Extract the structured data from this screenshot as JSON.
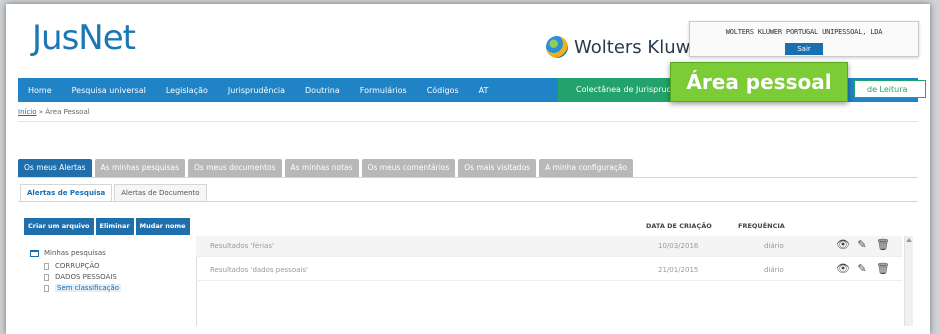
{
  "header": {
    "logo": "JusNet",
    "brand": "Wolters Kluwer",
    "company_name": "WOLTERS KLUWER PORTUGAL UNIPESSOAL, LDA",
    "logout_label": "Sair"
  },
  "nav": {
    "items": [
      "Home",
      "Pesquisa universal",
      "Legislação",
      "Jurisprudência",
      "Doutrina",
      "Formulários",
      "Códigos",
      "AT"
    ],
    "collection_label": "Colectânea de Jurisprudência",
    "reading_label": "de Leitura"
  },
  "badge": {
    "label": "Área pessoal"
  },
  "breadcrumb": {
    "home": "Início",
    "separator": " » ",
    "current": "Área Pessoal"
  },
  "tabs": [
    "Os meus Alertas",
    "As minhas pesquisas",
    "Os meus documentos",
    "As minhas notas",
    "Os meus comentários",
    "Os mais visitados",
    "A minha configuração"
  ],
  "subtabs": [
    "Alertas de Pesquisa",
    "Alertas de Documento"
  ],
  "actions": {
    "create_folder": "Criar um arquivo",
    "delete": "Eliminar",
    "rename": "Mudar nome"
  },
  "tree": {
    "root": "Minhas pesquisas",
    "children": [
      "CORRUPÇÃO",
      "DADOS PESSOAIS",
      "Sem classificação"
    ]
  },
  "table": {
    "columns": {
      "date": "DATA DE CRIAÇÃO",
      "frequency": "FREQUÊNCIA"
    },
    "rows": [
      {
        "title": "Resultados 'férias'",
        "date": "10/03/2016",
        "frequency": "diário"
      },
      {
        "title": "Resultados 'dados pessoais'",
        "date": "21/01/2015",
        "frequency": "diário"
      }
    ]
  },
  "colors": {
    "accent": "#1f83c6",
    "green": "#21a36b",
    "badge": "#7ccc35"
  }
}
